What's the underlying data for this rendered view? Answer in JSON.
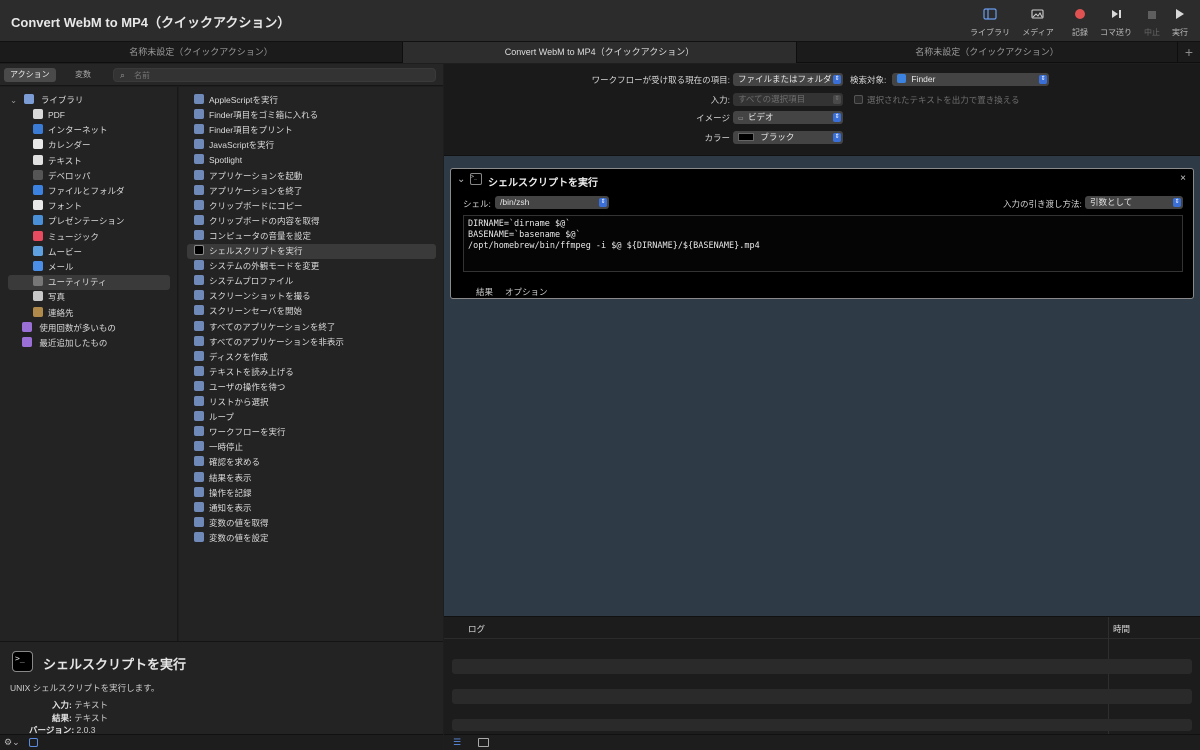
{
  "window": {
    "title": "Convert WebM to MP4（クイックアクション）"
  },
  "toolbar": {
    "library": "ライブラリ",
    "media": "メディア",
    "record": "記録",
    "step": "コマ送り",
    "stop": "中止",
    "run": "実行"
  },
  "tabs": [
    {
      "label": "名称未設定（クイックアクション）"
    },
    {
      "label": "Convert WebM to MP4（クイックアクション）"
    },
    {
      "label": "名称未設定（クイックアクション）"
    }
  ],
  "left_toggle": {
    "actions": "アクション",
    "variables": "変数"
  },
  "search": {
    "placeholder": "名前"
  },
  "library": {
    "root": "ライブラリ",
    "items": [
      {
        "label": "PDF",
        "color": "#d9d9d9",
        "glyph": ""
      },
      {
        "label": "インターネット",
        "color": "#3a7bd5",
        "glyph": ""
      },
      {
        "label": "カレンダー",
        "color": "#e8e8e8",
        "glyph": ""
      },
      {
        "label": "テキスト",
        "color": "#e0e0e0",
        "glyph": ""
      },
      {
        "label": "デベロッパ",
        "color": "#555555",
        "glyph": "✕"
      },
      {
        "label": "ファイルとフォルダ",
        "color": "#3c82e0",
        "glyph": ""
      },
      {
        "label": "フォント",
        "color": "#e8e8e8",
        "glyph": ""
      },
      {
        "label": "プレゼンテーション",
        "color": "#4a90d9",
        "glyph": ""
      },
      {
        "label": "ミュージック",
        "color": "#e84a5f",
        "glyph": "♪"
      },
      {
        "label": "ムービー",
        "color": "#5ea0e0",
        "glyph": ""
      },
      {
        "label": "メール",
        "color": "#4b8ee8",
        "glyph": ""
      },
      {
        "label": "ユーティリティ",
        "color": "#777777",
        "glyph": "✕"
      },
      {
        "label": "写真",
        "color": "#c8c8c8",
        "glyph": ""
      },
      {
        "label": "連絡先",
        "color": "#b08a4a",
        "glyph": ""
      }
    ],
    "smart": [
      {
        "label": "使用回数が多いもの"
      },
      {
        "label": "最近追加したもの"
      }
    ]
  },
  "actions": [
    {
      "label": "AppleScriptを実行"
    },
    {
      "label": "Finder項目をゴミ箱に入れる"
    },
    {
      "label": "Finder項目をプリント"
    },
    {
      "label": "JavaScriptを実行"
    },
    {
      "label": "Spotlight"
    },
    {
      "label": "アプリケーションを起動"
    },
    {
      "label": "アプリケーションを終了"
    },
    {
      "label": "クリップボードにコピー"
    },
    {
      "label": "クリップボードの内容を取得"
    },
    {
      "label": "コンピュータの音量を設定"
    },
    {
      "label": "シェルスクリプトを実行"
    },
    {
      "label": "システムの外観モードを変更"
    },
    {
      "label": "システムプロファイル"
    },
    {
      "label": "スクリーンショットを撮る"
    },
    {
      "label": "スクリーンセーバを開始"
    },
    {
      "label": "すべてのアプリケーションを終了"
    },
    {
      "label": "すべてのアプリケーションを非表示"
    },
    {
      "label": "ディスクを作成"
    },
    {
      "label": "テキストを読み上げる"
    },
    {
      "label": "ユーザの操作を待つ"
    },
    {
      "label": "リストから選択"
    },
    {
      "label": "ループ"
    },
    {
      "label": "ワークフローを実行"
    },
    {
      "label": "一時停止"
    },
    {
      "label": "確認を求める"
    },
    {
      "label": "結果を表示"
    },
    {
      "label": "操作を記録"
    },
    {
      "label": "通知を表示"
    },
    {
      "label": "変数の値を取得"
    },
    {
      "label": "変数の値を設定"
    }
  ],
  "selected_action_index": 10,
  "description": {
    "title": "シェルスクリプトを実行",
    "text": "UNIX シェルスクリプトを実行します。",
    "input_label": "入力:",
    "input_value": "テキスト",
    "result_label": "結果:",
    "result_value": "テキスト",
    "version_label": "バージョン:",
    "version_value": "2.0.3"
  },
  "workflow_header": {
    "receives_label": "ワークフローが受け取る現在の項目:",
    "receives_value": "ファイルまたはフォルダ",
    "search_target_label": "検索対象:",
    "search_target_value": "Finder",
    "input_label": "入力:",
    "input_value": "すべての選択項目",
    "replace_label": "選択されたテキストを出力で置き換える",
    "image_label": "イメージ",
    "image_value": "ビデオ",
    "color_label": "カラー",
    "color_value": "ブラック"
  },
  "shell_action": {
    "title": "シェルスクリプトを実行",
    "shell_label": "シェル:",
    "shell_value": "/bin/zsh",
    "pass_input_label": "入力の引き渡し方法:",
    "pass_input_value": "引数として",
    "code": [
      "DIRNAME=`dirname $@`",
      "BASENAME=`basename $@`",
      "/opt/homebrew/bin/ffmpeg -i $@ ${DIRNAME}/${BASENAME}.mp4"
    ],
    "tab_results": "結果",
    "tab_options": "オプション"
  },
  "log": {
    "col_log": "ログ",
    "col_time": "時間"
  }
}
